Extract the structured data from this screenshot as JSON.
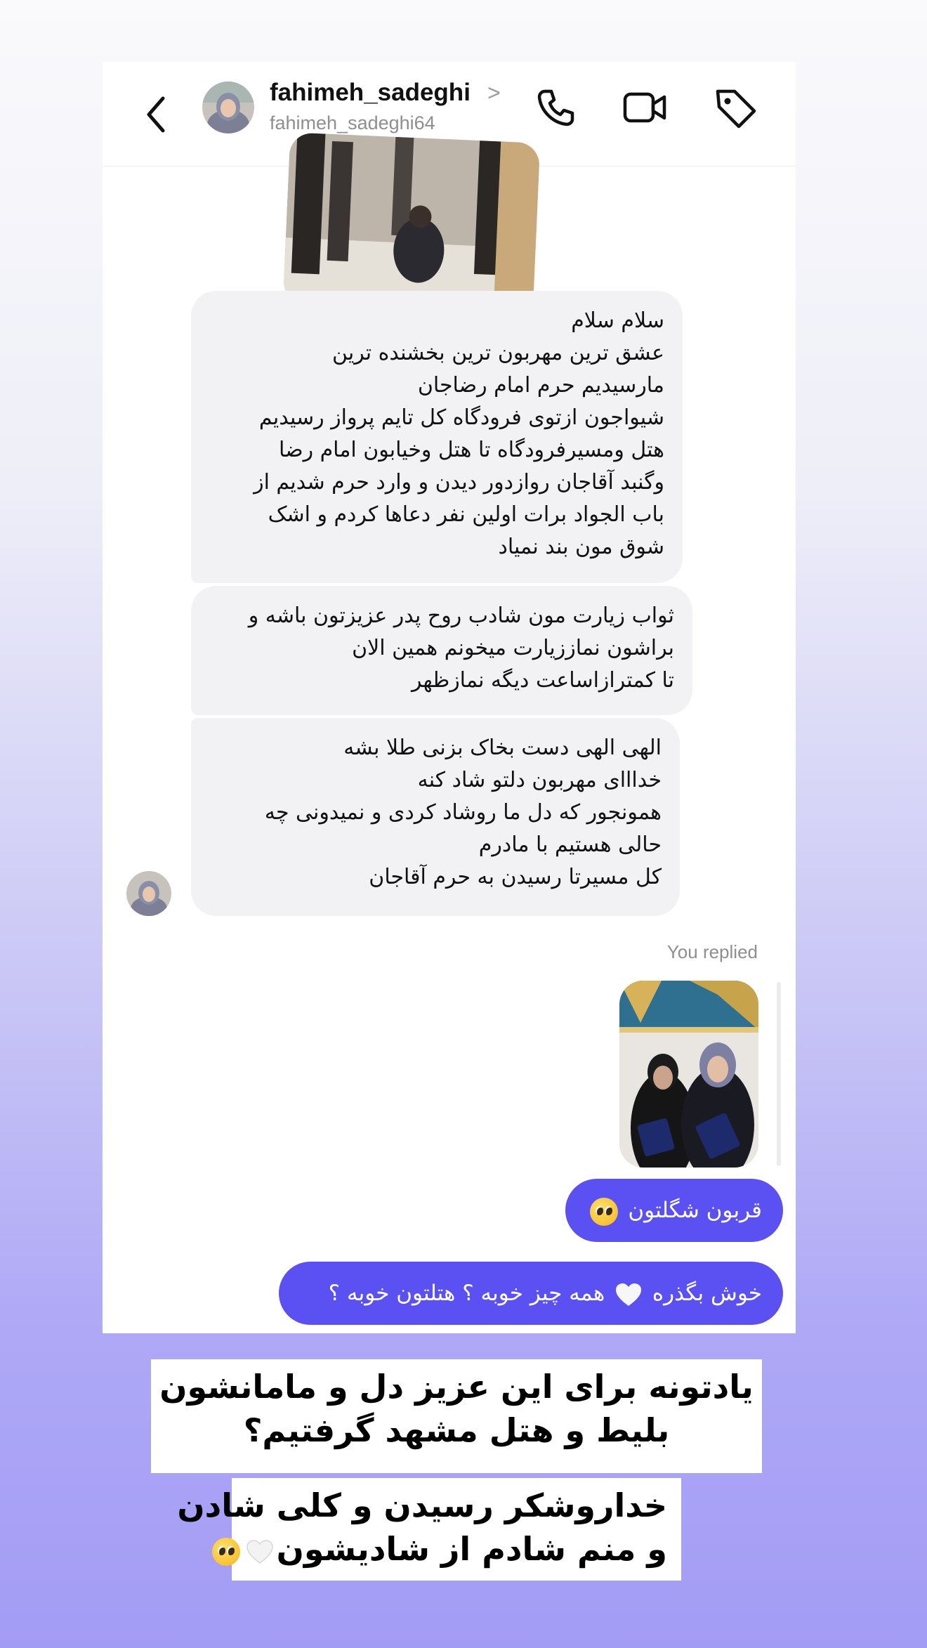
{
  "header": {
    "name": "fahimeh_sadeghi",
    "username": "fahimeh_sadeghi64",
    "chevron": ">",
    "icons": [
      "back-arrow-icon",
      "phone-icon",
      "video-icon",
      "tag-icon"
    ]
  },
  "thread": {
    "incoming": [
      {
        "lines": [
          "سلام سلام",
          "عشق ترین مهربون ترین بخشنده ترین",
          "مارسیدیم حرم امام رضاجان",
          "شیواجون ازتوی فرودگاه کل تایم پرواز رسیدیم",
          "هتل ومسیرفرودگاه تا هتل وخیابون امام رضا",
          "وگنبد آقاجان روازدور دیدن و وارد حرم شدیم از",
          "باب الجواد برات اولین نفر دعاها کردم و اشک",
          "شوق مون بند نمیاد"
        ]
      },
      {
        "lines": [
          "ثواب زیارت مون شادب روح پدر عزیزتون باشه و",
          "براشون نمازز‌یارت میخونم همین الان",
          "تا کمترازاساعت دیگه نمازظهر"
        ]
      },
      {
        "lines": [
          "الهی الهی دست بخاک بزنی طلا بشه",
          "خدااای مهربون دلتو شاد کنه",
          "همونجور که دل ما روشاد کردی و نمیدونی چه",
          "حالی هستیم با مادرم",
          "کل مسیرتا رسیدن به حرم آقاجان"
        ]
      }
    ],
    "replied_label": "You replied",
    "outgoing": [
      {
        "text": "قربون شگلتون",
        "emoji": "pleading-face"
      },
      {
        "text_before": "خوش بگذره",
        "text_after": "همه چیز خوبه ؟ هتلتون خوبه ؟",
        "emoji": "white-heart"
      }
    ]
  },
  "captions": {
    "top": {
      "lines": [
        "یادتونه برای این عزیز دل و مامانشون",
        "بلیط و هتل مشهد گرفتیم؟"
      ]
    },
    "bottom": {
      "line1": "خداروشکر رسیدن و کلی شادن",
      "line2": "و منم شادم از شادیشون",
      "emojis": [
        "white-heart",
        "pleading-face"
      ]
    }
  },
  "colors": {
    "outgoing_bubble": "#5b51f3",
    "incoming_bubble": "#f2f2f5",
    "background_top": "#fafafc",
    "background_bottom": "#a39cf5"
  }
}
